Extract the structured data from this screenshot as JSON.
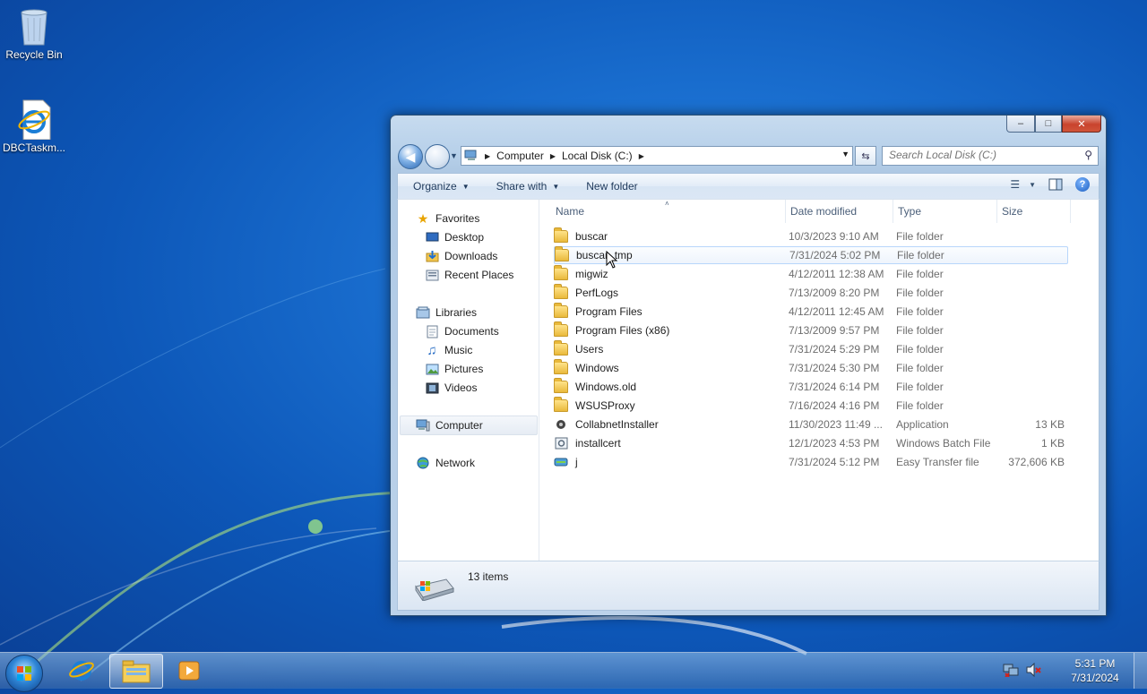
{
  "desktop": {
    "icons": [
      {
        "label": "Recycle Bin",
        "icon": "recycle-bin-icon"
      },
      {
        "label": "DBCTaskm...",
        "icon": "internet-explorer-shortcut-icon"
      }
    ]
  },
  "window": {
    "caption": {
      "minimize": "–",
      "maximize": "□",
      "close": "✕"
    },
    "address": {
      "crumbs": [
        "Computer",
        "Local Disk (C:)"
      ]
    },
    "search": {
      "placeholder": "Search Local Disk (C:)"
    },
    "toolbar": {
      "organize": "Organize",
      "share_with": "Share with",
      "new_folder": "New folder",
      "help": "?"
    },
    "nav_pane": {
      "favorites": {
        "label": "Favorites",
        "items": [
          "Desktop",
          "Downloads",
          "Recent Places"
        ]
      },
      "libraries": {
        "label": "Libraries",
        "items": [
          "Documents",
          "Music",
          "Pictures",
          "Videos"
        ]
      },
      "computer": "Computer",
      "network": "Network"
    },
    "columns": {
      "name": "Name",
      "date": "Date modified",
      "type": "Type",
      "size": "Size"
    },
    "files": [
      {
        "name": "buscar",
        "date": "10/3/2023 9:10 AM",
        "type": "File folder",
        "size": "",
        "kind": "folder"
      },
      {
        "name": "buscar_tmp",
        "date": "7/31/2024 5:02 PM",
        "type": "File folder",
        "size": "",
        "kind": "folder"
      },
      {
        "name": "migwiz",
        "date": "4/12/2011 12:38 AM",
        "type": "File folder",
        "size": "",
        "kind": "folder"
      },
      {
        "name": "PerfLogs",
        "date": "7/13/2009 8:20 PM",
        "type": "File folder",
        "size": "",
        "kind": "folder"
      },
      {
        "name": "Program Files",
        "date": "4/12/2011 12:45 AM",
        "type": "File folder",
        "size": "",
        "kind": "folder"
      },
      {
        "name": "Program Files (x86)",
        "date": "7/13/2009 9:57 PM",
        "type": "File folder",
        "size": "",
        "kind": "folder"
      },
      {
        "name": "Users",
        "date": "7/31/2024 5:29 PM",
        "type": "File folder",
        "size": "",
        "kind": "folder"
      },
      {
        "name": "Windows",
        "date": "7/31/2024 5:30 PM",
        "type": "File folder",
        "size": "",
        "kind": "folder"
      },
      {
        "name": "Windows.old",
        "date": "7/31/2024 6:14 PM",
        "type": "File folder",
        "size": "",
        "kind": "folder"
      },
      {
        "name": "WSUSProxy",
        "date": "7/16/2024 4:16 PM",
        "type": "File folder",
        "size": "",
        "kind": "folder"
      },
      {
        "name": "CollabnetInstaller",
        "date": "11/30/2023 11:49 ...",
        "type": "Application",
        "size": "13 KB",
        "kind": "app"
      },
      {
        "name": "installcert",
        "date": "12/1/2023 4:53 PM",
        "type": "Windows Batch File",
        "size": "1 KB",
        "kind": "batch"
      },
      {
        "name": "j",
        "date": "7/31/2024 5:12 PM",
        "type": "Easy Transfer file",
        "size": "372,606 KB",
        "kind": "transfer"
      }
    ],
    "status": {
      "count": "13 items"
    }
  },
  "taskbar": {
    "time": "5:31 PM",
    "date": "7/31/2024"
  }
}
